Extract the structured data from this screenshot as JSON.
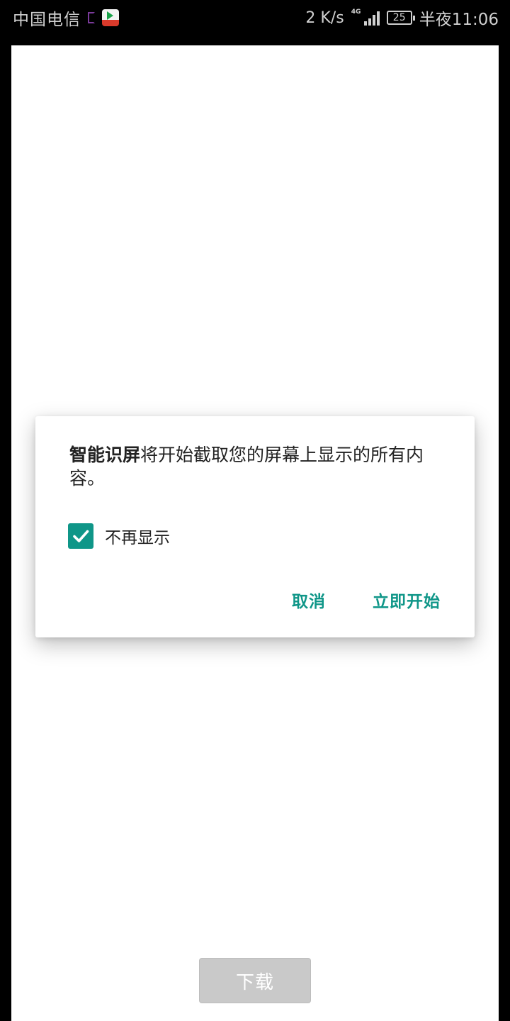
{
  "status_bar": {
    "carrier": "中国电信",
    "net_speed": "2 K/s",
    "network_type": "4G",
    "battery_level": "25",
    "time": "半夜11:06",
    "icons": [
      "notification-icon",
      "video-app-icon",
      "signal-icon",
      "battery-icon"
    ]
  },
  "dialog": {
    "app_name": "智能识屏",
    "message": "将开始截取您的屏幕上显示的所有内容。",
    "checkbox_label": "不再显示",
    "checkbox_checked": true,
    "cancel_label": "取消",
    "confirm_label": "立即开始",
    "accent_color": "#0f9688"
  },
  "page": {
    "download_label": "下载"
  }
}
